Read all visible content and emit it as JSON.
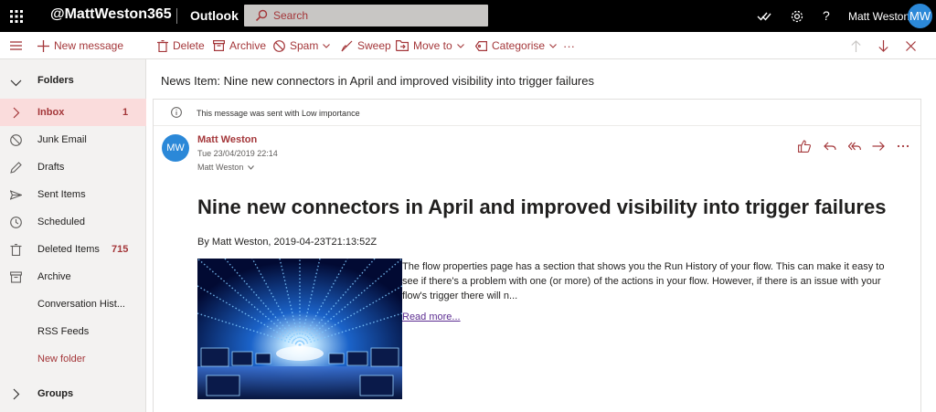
{
  "topbar": {
    "org": "@MattWeston365",
    "app": "Outlook",
    "search_placeholder": "Search",
    "help": "?",
    "user_name": "Matt Weston",
    "user_initials": "MW"
  },
  "commands": {
    "new_message": "New message",
    "delete": "Delete",
    "archive": "Archive",
    "spam": "Spam",
    "sweep": "Sweep",
    "move_to": "Move to",
    "categorise": "Categorise",
    "more": "···"
  },
  "nav": {
    "folders": "Folders",
    "inbox": "Inbox",
    "inbox_count": "1",
    "junk": "Junk Email",
    "drafts": "Drafts",
    "sent": "Sent Items",
    "scheduled": "Scheduled",
    "deleted": "Deleted Items",
    "deleted_count": "715",
    "archive": "Archive",
    "conversation": "Conversation Hist...",
    "rss": "RSS Feeds",
    "new_folder": "New folder",
    "groups": "Groups"
  },
  "message": {
    "subject": "News Item: Nine new connectors in April and improved visibility into trigger failures",
    "importance_note": "This message was sent with Low importance",
    "sender_initials": "MW",
    "sender": "Matt Weston",
    "date": "Tue 23/04/2019 22:14",
    "to": "Matt Weston",
    "headline": "Nine new connectors in April and improved visibility into trigger failures",
    "byline": "By Matt Weston, 2019-04-23T21:13:52Z",
    "body": "The flow properties page has a section that shows you the Run History of your flow. This can make it easy to see if there's a problem with one (or more) of the actions in your flow. However, if there is an issue with your flow's trigger there will n...",
    "read_more": "Read more..."
  },
  "colors": {
    "accent": "#a4373a",
    "selected_bg": "#fadcdc",
    "avatar": "#2b88d8"
  }
}
